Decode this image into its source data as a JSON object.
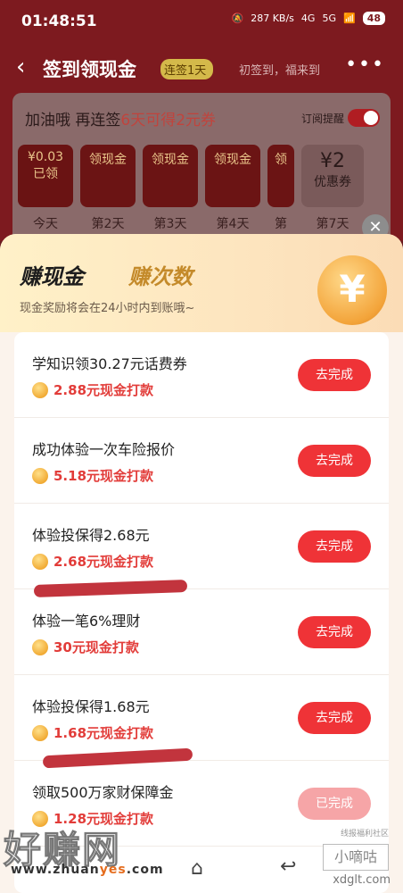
{
  "status_bar": {
    "time": "01:48:51",
    "net_speed": "287 KB/s",
    "net1": "4G",
    "net2": "5G",
    "battery": "48"
  },
  "topbar": {
    "back_icon": "chevron-left-icon",
    "title": "签到领现金",
    "streak_badge": "连签1天",
    "hint": "初签到，福来到",
    "more_icon": "more-icon"
  },
  "sign_card": {
    "headline_prefix": "加油哦",
    "headline_mid": "再连签",
    "days_left": "6天可得",
    "reward": "2元券",
    "subscribe_label": "订阅提醒",
    "days": [
      {
        "top": "¥0.03",
        "bottom": "已领",
        "label": "今天"
      },
      {
        "top": "领现金",
        "bottom": "",
        "label": "第2天"
      },
      {
        "top": "领现金",
        "bottom": "",
        "label": "第3天"
      },
      {
        "top": "领现金",
        "bottom": "",
        "label": "第4天"
      },
      {
        "top": "领",
        "bottom": "",
        "label": "第"
      },
      {
        "top": "¥2",
        "bottom": "优惠券",
        "label": "第7天"
      }
    ]
  },
  "sheet": {
    "tab_earn_cash": "赚现金",
    "tab_earn_count": "赚次数",
    "note": "现金奖励将会在24小时内到账哦~",
    "coin_symbol": "¥",
    "close_label": "✕"
  },
  "tasks": [
    {
      "name": "学知识领30.27元话费券",
      "reward": "2.88元现金打款",
      "button": "去完成"
    },
    {
      "name": "成功体验一次车险报价",
      "reward": "5.18元现金打款",
      "button": "去完成"
    },
    {
      "name": "体验投保得2.68元",
      "reward": "2.68元现金打款",
      "button": "去完成"
    },
    {
      "name": "体验一笔6%理财",
      "reward": "30元现金打款",
      "button": "去完成"
    },
    {
      "name": "体验投保得1.68元",
      "reward": "1.68元现金打款",
      "button": "去完成"
    },
    {
      "name": "领取500万家财保障金",
      "reward": "1.28元现金打款",
      "button": "已完成"
    }
  ],
  "watermark": {
    "left_title": "好赚网",
    "url_prefix": "www.zhuan",
    "url_hl": "yes",
    "url_suffix": ".com",
    "right_small": "线报福利社区",
    "right_box": "小嘀咕",
    "right_url": "xdglt.com"
  }
}
